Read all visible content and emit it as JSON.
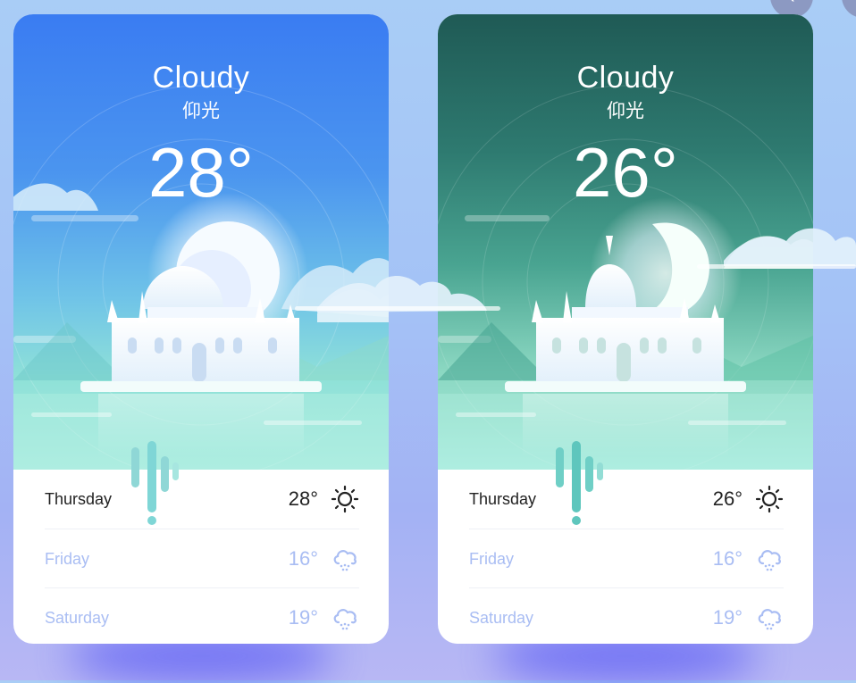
{
  "nav": {
    "prev_label": "‹",
    "next_label": "›"
  },
  "cards": [
    {
      "theme": "day",
      "condition": "Cloudy",
      "location": "仰光",
      "temperature": "28°",
      "celestial_icon": "sun-icon",
      "forecast": [
        {
          "day": "Thursday",
          "temp": "28°",
          "icon": "sun-icon"
        },
        {
          "day": "Friday",
          "temp": "16°",
          "icon": "rain-cloud-icon"
        },
        {
          "day": "Saturday",
          "temp": "19°",
          "icon": "rain-cloud-icon"
        }
      ]
    },
    {
      "theme": "night",
      "condition": "Cloudy",
      "location": "仰光",
      "temperature": "26°",
      "celestial_icon": "moon-icon",
      "forecast": [
        {
          "day": "Thursday",
          "temp": "26°",
          "icon": "sun-icon"
        },
        {
          "day": "Friday",
          "temp": "16°",
          "icon": "rain-cloud-icon"
        },
        {
          "day": "Saturday",
          "temp": "19°",
          "icon": "rain-cloud-icon"
        }
      ]
    }
  ],
  "colors": {
    "day_top": "#3a7cf2",
    "night_top": "#1f5a55",
    "muted_text": "#a9bdf3",
    "accent_drip": "#7fd6d6"
  }
}
